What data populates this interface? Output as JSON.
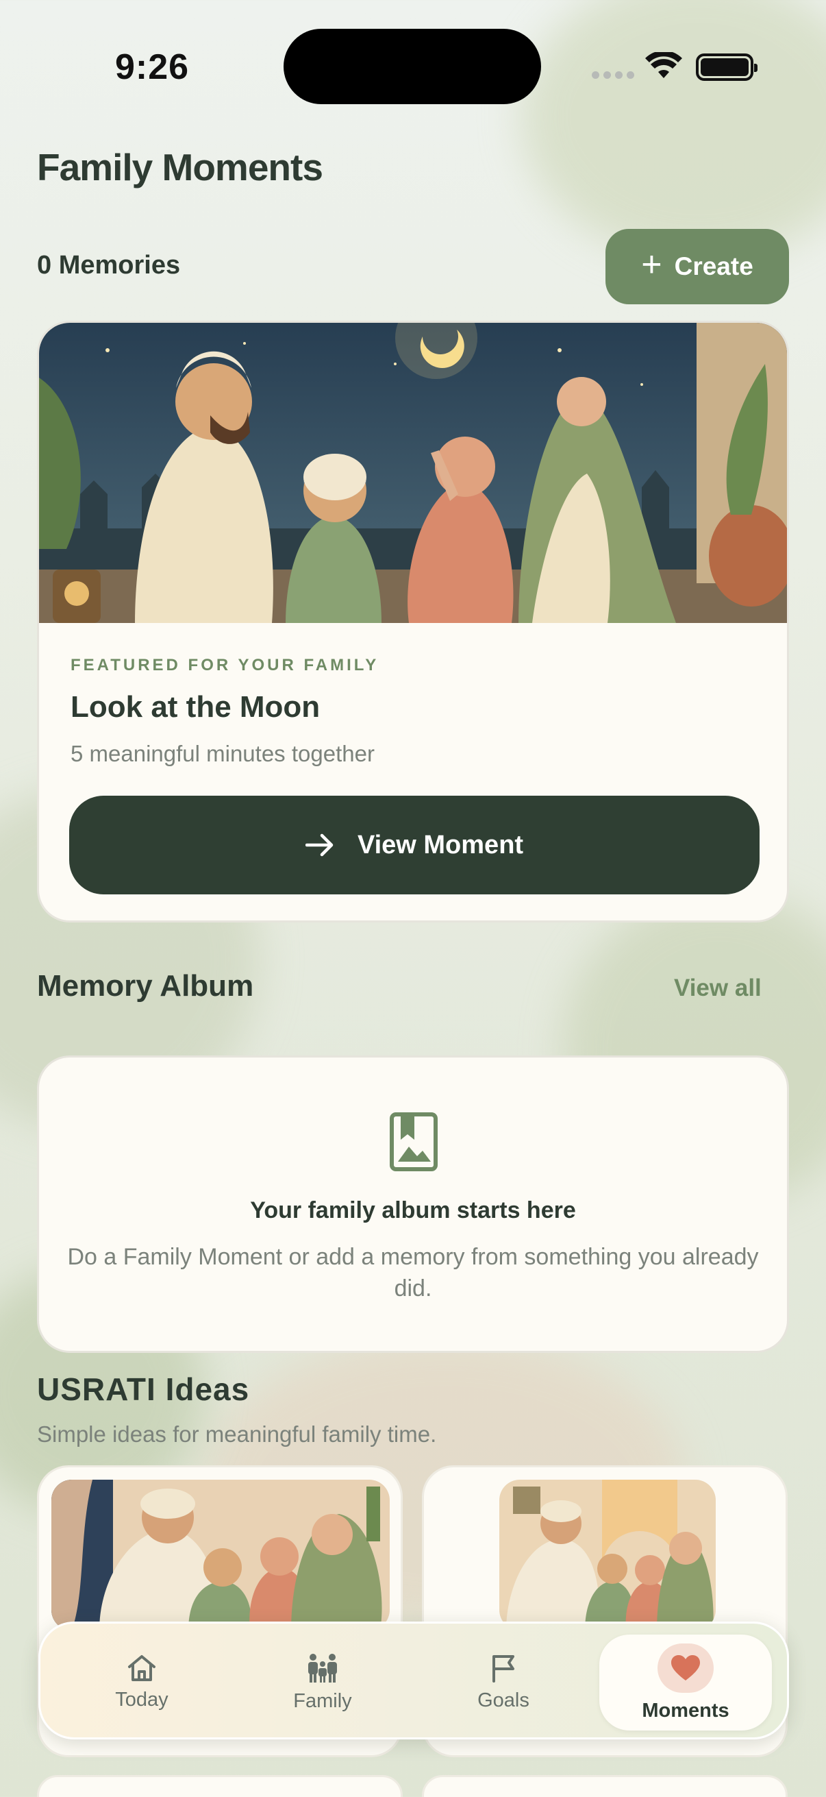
{
  "status_bar": {
    "time": "9:26"
  },
  "header": {
    "title": "Family Moments",
    "memories_count": "0 Memories",
    "create_label": "Create"
  },
  "featured": {
    "eyebrow": "FEATURED FOR YOUR FAMILY",
    "title": "Look at the Moon",
    "subtitle": "5 meaningful minutes together",
    "button_label": "View Moment"
  },
  "album": {
    "title": "Memory Album",
    "view_all": "View all",
    "empty_heading": "Your family album starts here",
    "empty_body": "Do a Family Moment or add a memory from something you already did."
  },
  "ideas": {
    "title": "USRATI Ideas",
    "subtitle": "Simple ideas for meaningful family time."
  },
  "nav": {
    "items": [
      {
        "label": "Today",
        "icon": "home-icon"
      },
      {
        "label": "Family",
        "icon": "family-icon"
      },
      {
        "label": "Goals",
        "icon": "flag-icon"
      },
      {
        "label": "Moments",
        "icon": "heart-icon",
        "active": true
      }
    ]
  },
  "colors": {
    "accent": "#6f8b64",
    "dark_button": "#2f3f33",
    "heart": "#d8735a"
  }
}
